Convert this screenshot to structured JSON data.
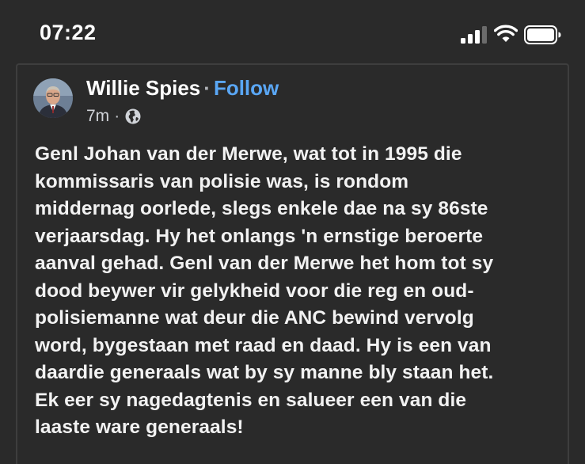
{
  "status_bar": {
    "time": "07:22",
    "icons": [
      "cellular-signal-icon",
      "wifi-icon",
      "battery-icon"
    ]
  },
  "post": {
    "author": "Willie Spies",
    "separator": "·",
    "follow_label": "Follow",
    "timestamp": "7m",
    "meta_separator": "·",
    "audience_icon": "globe-icon",
    "body_lines": [
      "Genl Johan van der Merwe, wat tot in 1995 die",
      "kommissaris van polisie was, is rondom",
      "middernag oorlede, slegs enkele dae na sy 86ste",
      "verjaarsdag. Hy het onlangs 'n ernstige beroerte",
      "aanval gehad.  Genl van der Merwe het hom tot sy",
      "dood beywer vir gelykheid voor die reg en oud-",
      "polisiemanne wat deur die ANC bewind vervolg",
      "word, bygestaan met raad en daad. Hy is een van",
      "daardie generaals wat by sy manne bly staan het.",
      "Ek eer sy nagedagtenis en salueer een van die",
      "laaste ware generaals!"
    ]
  },
  "colors": {
    "background": "#2a2a2a",
    "text": "#ffffff",
    "link": "#5aa7f5",
    "meta": "#d0d3d8"
  }
}
